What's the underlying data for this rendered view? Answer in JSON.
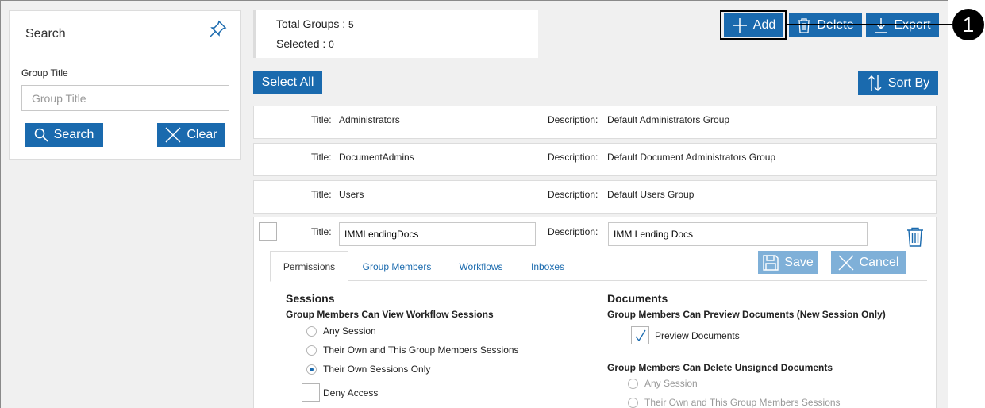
{
  "search_panel": {
    "heading": "Search",
    "field_label": "Group Title",
    "field_placeholder": "Group Title",
    "search_label": "Search",
    "clear_label": "Clear"
  },
  "summary": {
    "total_label": "Total Groups : ",
    "total_value": "5",
    "selected_label": "Selected : ",
    "selected_value": "0"
  },
  "toolbar": {
    "add_label": "Add",
    "delete_label": "Delete",
    "export_label": "Export",
    "select_all_label": "Select All",
    "sort_label": "Sort By"
  },
  "rows": [
    {
      "title_label": "Title:",
      "title": "Administrators",
      "desc_label": "Description:",
      "description": "Default Administrators Group"
    },
    {
      "title_label": "Title:",
      "title": "DocumentAdmins",
      "desc_label": "Description:",
      "description": "Default Document Administrators Group"
    },
    {
      "title_label": "Title:",
      "title": "Users",
      "desc_label": "Description:",
      "description": "Default Users Group"
    }
  ],
  "edit": {
    "title_label": "Title:",
    "title_value": "IMMLendingDocs",
    "desc_label": "Description:",
    "desc_value": "IMM Lending Docs",
    "save_label": "Save",
    "cancel_label": "Cancel",
    "tabs": [
      "Permissions",
      "Group Members",
      "Workflows",
      "Inboxes"
    ],
    "sessions": {
      "heading": "Sessions",
      "subheading": "Group Members Can View Workflow Sessions",
      "options": [
        "Any Session",
        "Their Own and This Group Members Sessions",
        "Their Own Sessions Only"
      ],
      "selected_index": 2,
      "deny_label": "Deny Access"
    },
    "documents": {
      "heading": "Documents",
      "preview_subheading": "Group Members Can Preview Documents (New Session Only)",
      "preview_label": "Preview Documents",
      "preview_checked": true,
      "delete_subheading": "Group Members Can Delete Unsigned Documents",
      "delete_options": [
        "Any Session",
        "Their Own and This Group Members Sessions"
      ]
    }
  },
  "callout": {
    "number": "1"
  },
  "colors": {
    "accent": "#1a6aae",
    "accent_disabled": "#7fb0d8",
    "background": "#f0f0f0"
  }
}
